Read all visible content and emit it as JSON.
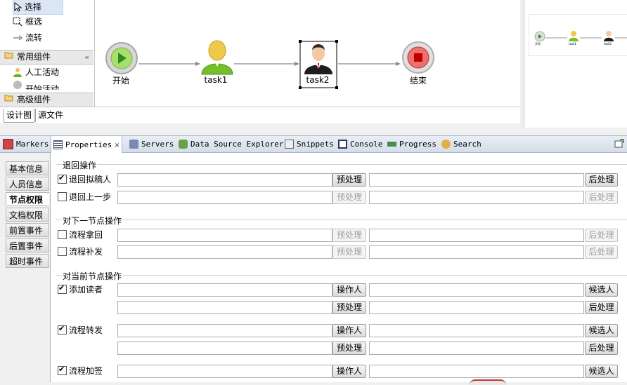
{
  "palette": {
    "tools": [
      {
        "label": "选择"
      },
      {
        "label": "框选"
      },
      {
        "label": "流转"
      }
    ],
    "groups": {
      "common": {
        "label": "常用组件",
        "items": [
          {
            "label": "人工活动"
          },
          {
            "label": "开始活动"
          }
        ]
      },
      "advanced": {
        "label": "高级组件"
      }
    }
  },
  "canvas": {
    "nodes": {
      "start": {
        "label": "开始"
      },
      "task1": {
        "label": "task1"
      },
      "task2": {
        "label": "task2"
      },
      "end": {
        "label": "结束"
      }
    }
  },
  "editor_tabs": [
    {
      "label": "设计图"
    },
    {
      "label": "源文件"
    }
  ],
  "outline": {
    "labels": [
      "开始",
      "task1",
      "task2"
    ]
  },
  "view_tabs": [
    {
      "label": "Markers"
    },
    {
      "label": "Properties"
    },
    {
      "label": "Servers"
    },
    {
      "label": "Data Source Explorer"
    },
    {
      "label": "Snippets"
    },
    {
      "label": "Console"
    },
    {
      "label": "Progress"
    },
    {
      "label": "Search"
    }
  ],
  "side_tabs": [
    {
      "label": "基本信息"
    },
    {
      "label": "人员信息"
    },
    {
      "label": "节点权限"
    },
    {
      "label": "文档权限"
    },
    {
      "label": "前置事件"
    },
    {
      "label": "后置事件"
    },
    {
      "label": "超时事件"
    }
  ],
  "form": {
    "sections": [
      {
        "title": "退回操作"
      },
      {
        "title": "对下一节点操作"
      },
      {
        "title": "对当前节点操作"
      }
    ],
    "rows": [
      {
        "label": "退回拟稿人",
        "checked": true,
        "btn1": "预处理",
        "btn2": "后处理",
        "enabled": true
      },
      {
        "label": "退回上一步",
        "checked": false,
        "btn1": "预处理",
        "btn2": "后处理",
        "enabled": false
      },
      {
        "label": "流程拿回",
        "checked": false,
        "btn1": "预处理",
        "btn2": "后处理",
        "enabled": false
      },
      {
        "label": "流程补发",
        "checked": false,
        "btn1": "预处理",
        "btn2": "后处理",
        "enabled": false
      },
      {
        "label": "添加读者",
        "checked": true,
        "btn1": "操作人",
        "btn2": "候选人",
        "btn3": "预处理",
        "btn4": "后处理",
        "enabled": true
      },
      {
        "label": "流程转发",
        "checked": true,
        "btn1": "操作人",
        "btn2": "候选人",
        "btn3": "预处理",
        "btn4": "后处理",
        "enabled": true
      },
      {
        "label": "流程加签",
        "checked": true,
        "btn1": "操作人",
        "btn2": "候选人",
        "enabled": true
      }
    ]
  }
}
